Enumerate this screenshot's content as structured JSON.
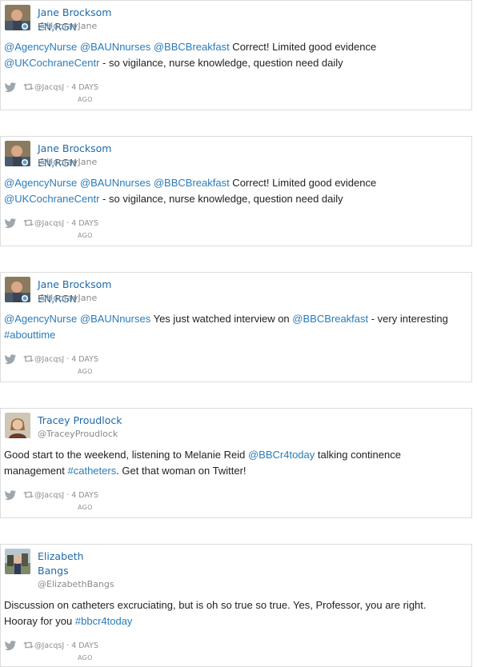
{
  "tweets": [
    {
      "name": "Jane Brocksom EN,RGN",
      "handle": "@HoorayJane",
      "line1": [
        {
          "t": "@AgencyNurse",
          "link": true
        },
        {
          "t": " ",
          "link": false
        },
        {
          "t": "@BAUNnurses",
          "link": true
        },
        {
          "t": " ",
          "link": false
        },
        {
          "t": "@BBCBreakfast",
          "link": true
        },
        {
          "t": " Correct! Limited good evidence",
          "link": false
        }
      ],
      "line2": [
        {
          "t": "@UKCochraneCentr",
          "link": true
        },
        {
          "t": " - so vigilance, nurse knowledge, question need daily",
          "link": false
        }
      ],
      "retweeter": "@JacqsJ",
      "time": "· 4 DAYS",
      "ago": "AGO",
      "avatar": "person-photo-1"
    },
    {
      "name": "Jane Brocksom EN,RGN",
      "handle": "@HoorayJane",
      "line1": [
        {
          "t": "@AgencyNurse",
          "link": true
        },
        {
          "t": " ",
          "link": false
        },
        {
          "t": "@BAUNnurses",
          "link": true
        },
        {
          "t": " ",
          "link": false
        },
        {
          "t": "@BBCBreakfast",
          "link": true
        },
        {
          "t": " Correct! Limited good evidence",
          "link": false
        }
      ],
      "line2": [
        {
          "t": "@UKCochraneCentr",
          "link": true
        },
        {
          "t": " - so vigilance, nurse knowledge, question need daily",
          "link": false
        }
      ],
      "retweeter": "@JacqsJ",
      "time": "· 4 DAYS",
      "ago": "AGO",
      "avatar": "person-photo-1"
    },
    {
      "name": "Jane Brocksom EN,RGN",
      "handle": "@HoorayJane",
      "line1": [
        {
          "t": "@AgencyNurse",
          "link": true
        },
        {
          "t": " ",
          "link": false
        },
        {
          "t": "@BAUNnurses",
          "link": true
        },
        {
          "t": " Yes just watched interview on ",
          "link": false
        },
        {
          "t": "@BBCBreakfast",
          "link": true
        },
        {
          "t": " - very interesting",
          "link": false
        }
      ],
      "line2": [
        {
          "t": "#abouttime",
          "link": true
        }
      ],
      "retweeter": "@JacqsJ",
      "time": "· 4 DAYS",
      "ago": "AGO",
      "avatar": "person-photo-1"
    },
    {
      "name": "Tracey Proudlock",
      "handle": "@TraceyProudlock",
      "line1": [
        {
          "t": "Good start to the weekend, listening to Melanie Reid  ",
          "link": false
        },
        {
          "t": "@BBCr4today",
          "link": true
        },
        {
          "t": " talking continence",
          "link": false
        }
      ],
      "line2": [
        {
          "t": "management ",
          "link": false
        },
        {
          "t": "#catheters",
          "link": true
        },
        {
          "t": ". Get that woman on Twitter!",
          "link": false
        }
      ],
      "retweeter": "@JacqsJ",
      "time": "· 4 DAYS",
      "ago": "AGO",
      "avatar": "person-photo-2"
    },
    {
      "name": "Elizabeth Bangs",
      "handle": "@ElizabethBangs",
      "line1": [
        {
          "t": "Discussion on catheters excruciating, but is oh so true so true. Yes, Professor, you are right.",
          "link": false
        }
      ],
      "line2": [
        {
          "t": "Hooray for you ",
          "link": false
        },
        {
          "t": "#bbcr4today",
          "link": true
        }
      ],
      "retweeter": "@JacqsJ",
      "time": "· 4 DAYS",
      "ago": "AGO",
      "avatar": "person-photo-3"
    }
  ],
  "colors": {
    "link": "#2b7bb9",
    "name": "#1f6aa8",
    "muted": "#8a8a8a",
    "border": "#dcdcdc"
  }
}
